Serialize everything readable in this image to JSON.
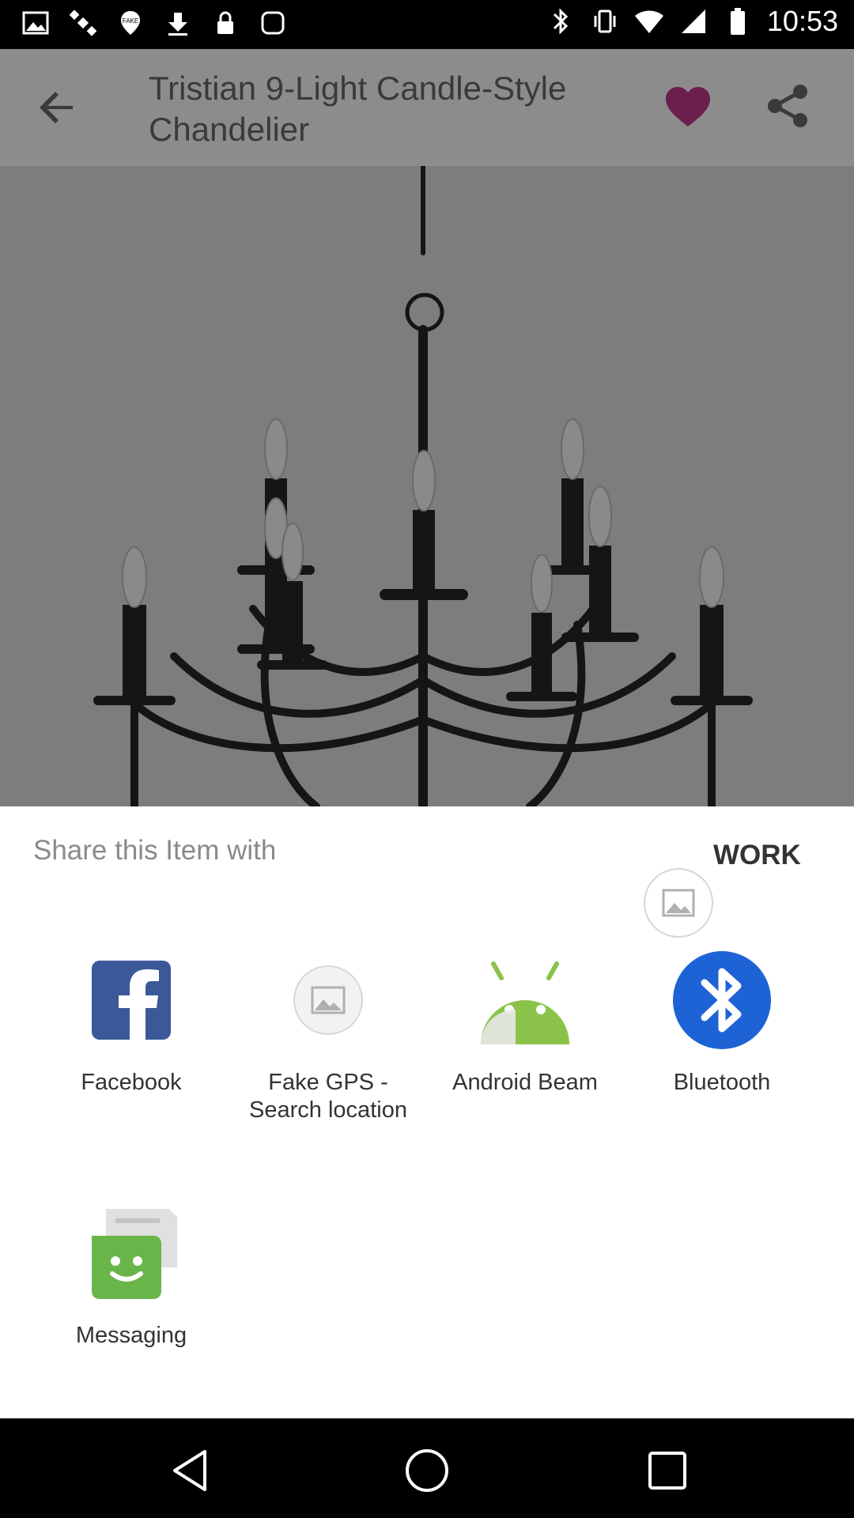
{
  "status_bar": {
    "time": "10:53",
    "left_icons": [
      "image-icon",
      "satellite-icon",
      "fake-gps-icon",
      "download-icon",
      "lock-icon",
      "app-icon"
    ],
    "right_icons": [
      "bluetooth-icon",
      "vibrate-icon",
      "wifi-icon",
      "signal-icon",
      "battery-icon"
    ]
  },
  "app_bar": {
    "title": "Tristian 9-Light Candle-Style Chandelier",
    "heart_color": "#6b1f4d"
  },
  "share_sheet": {
    "title": "Share this Item with",
    "work_label": "WORK",
    "apps": [
      {
        "label": "Facebook",
        "icon": "facebook-icon"
      },
      {
        "label": "Fake GPS - Search location",
        "icon": "image-placeholder-icon"
      },
      {
        "label": "Android Beam",
        "icon": "android-icon"
      },
      {
        "label": "Bluetooth",
        "icon": "bluetooth-icon"
      },
      {
        "label": "Messaging",
        "icon": "messaging-icon"
      }
    ]
  },
  "colors": {
    "facebook": "#3b5998",
    "android": "#8bc34a",
    "bluetooth": "#1e63d6",
    "messaging": "#6ab54a"
  },
  "nav_bar": {
    "icons": [
      "back-triangle-icon",
      "home-circle-icon",
      "recents-square-icon"
    ]
  }
}
